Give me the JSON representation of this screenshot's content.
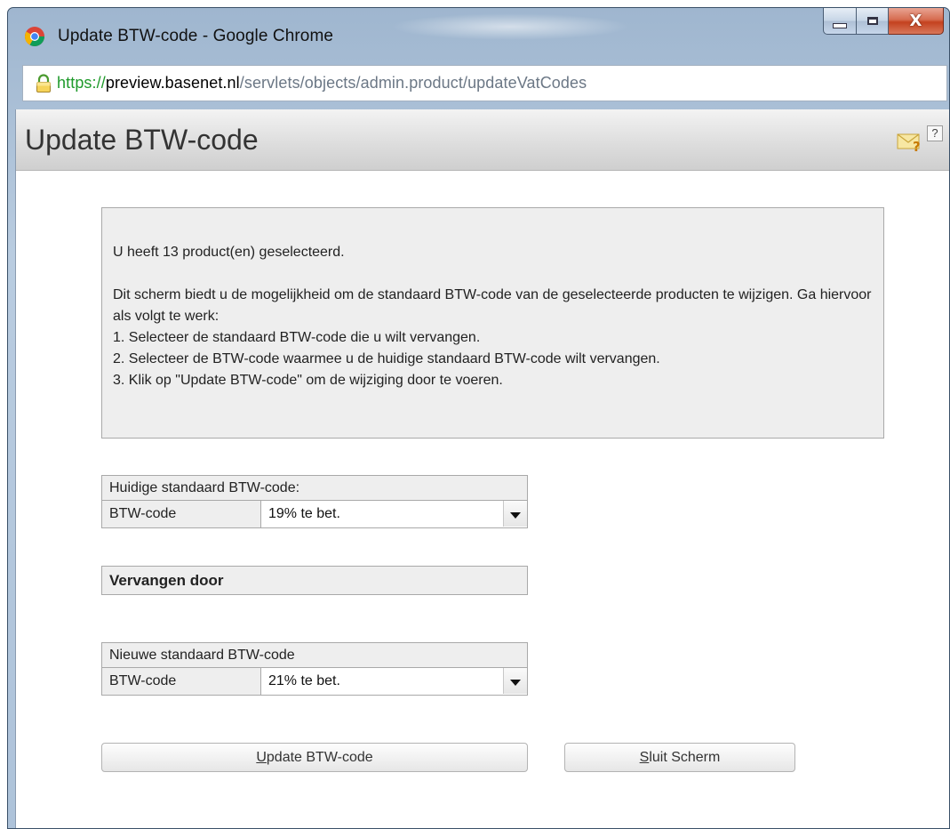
{
  "window": {
    "title": "Update BTW-code - Google Chrome",
    "close_glyph": "X"
  },
  "address": {
    "scheme": "https",
    "separator": "://",
    "host": "preview.basenet.nl",
    "path": "/servlets/objects/admin.product/updateVatCodes"
  },
  "page": {
    "title": "Update BTW-code",
    "help_glyph": "?"
  },
  "info": {
    "selected": "U heeft 13 product(en) geselecteerd.",
    "intro": "Dit scherm biedt u de mogelijkheid om de standaard BTW-code van de geselecteerde producten te wijzigen. Ga hiervoor als volgt te werk:",
    "step1": "1. Selecteer de standaard BTW-code die u wilt vervangen.",
    "step2": "2. Selecteer de BTW-code waarmee u de huidige standaard BTW-code wilt vervangen.",
    "step3": "3. Klik op \"Update BTW-code\" om de wijziging door te voeren."
  },
  "current": {
    "header": "Huidige standaard BTW-code:",
    "label": "BTW-code",
    "value": "19% te bet."
  },
  "replace": {
    "header": "Vervangen door"
  },
  "new": {
    "header": "Nieuwe standaard BTW-code",
    "label": "BTW-code",
    "value": "21% te bet."
  },
  "buttons": {
    "update_mnemonic": "U",
    "update_rest": "pdate BTW-code",
    "close_mnemonic": "S",
    "close_rest": "luit Scherm"
  },
  "icons": {
    "app": "chrome-icon",
    "lock": "lock-icon",
    "mail": "mail-help-icon",
    "help": "help-icon",
    "dropdown": "chevron-down-icon"
  },
  "colors": {
    "secure_green": "#1f9a2b",
    "panel_bg": "#eeeeee",
    "close_red": "#c4421f"
  }
}
